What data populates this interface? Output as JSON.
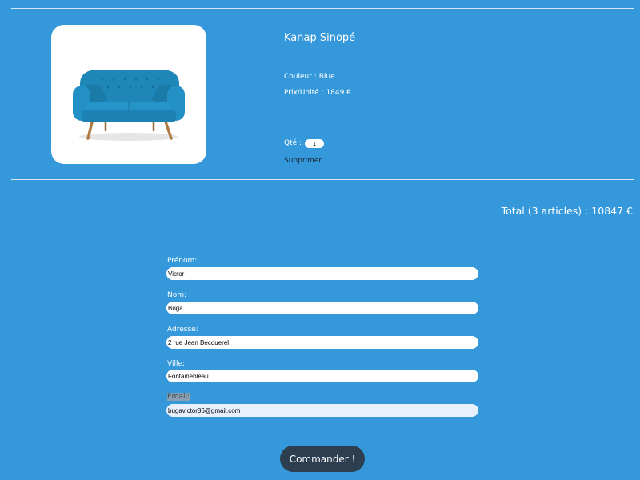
{
  "cart": {
    "item": {
      "image_alt": "sofa photo",
      "name": "Kanap Sinopé",
      "color_text": "Couleur : Blue",
      "price_text": "Prix/Unité : 1849 €",
      "qty_label": "Qté :",
      "qty_value": "1",
      "delete_label": "Supprimer"
    },
    "total_text": "Total (3 articles) : 10847 €"
  },
  "form": {
    "first_name": {
      "label": "Prénom:",
      "value": "Victor"
    },
    "last_name": {
      "label": "Nom:",
      "value": "Buga"
    },
    "address": {
      "label": "Adresse:",
      "value": "2 rue Jean Becquerel"
    },
    "city": {
      "label": "Ville:",
      "value": "Fontainebleau"
    },
    "email": {
      "label": "Email:",
      "value": "bugavictor86@gmail.com"
    },
    "submit_label": "Commander !"
  },
  "colors": {
    "background": "#3498db",
    "button": "#2c3e50",
    "autofill": "#e8f0fe"
  }
}
